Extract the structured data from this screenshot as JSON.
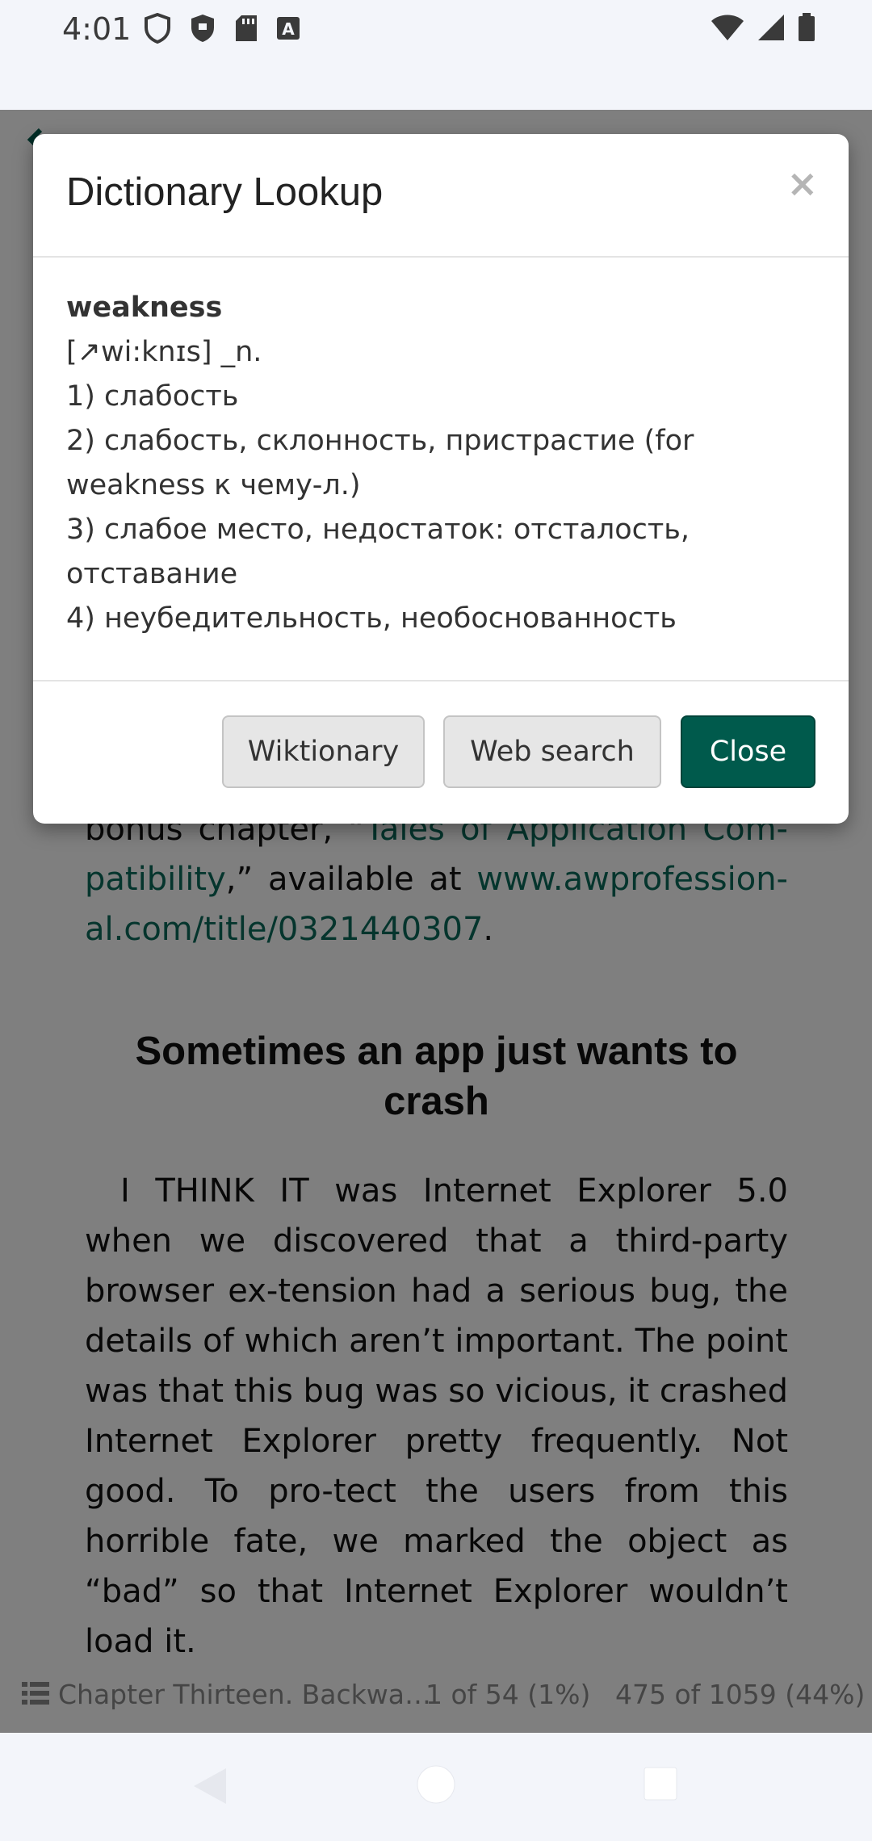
{
  "status_bar": {
    "time": "4:01",
    "left_icons": [
      "shield-outline-icon",
      "shield-filled-icon",
      "sd-card-icon",
      "font-a-icon"
    ],
    "right_icons": [
      "wifi-icon",
      "cell-signal-icon",
      "battery-icon"
    ]
  },
  "dialog": {
    "title": "Dictionary Lookup",
    "close_glyph": "×",
    "word": "weakness",
    "entry_lines": [
      "[↗wi:knɪs] _n.",
      "1) слабость",
      "2) слабость, склонность, пристрастие (for weakness к чему-л.)",
      "3) слабое место, недостаток: отсталость, отставание",
      "4) неубедительность, необоснованность"
    ],
    "buttons": {
      "wiktionary": "Wiktionary",
      "web_search": "Web search",
      "close": "Close"
    }
  },
  "reader": {
    "para1_text_a": "bonus chapter, “",
    "para1_link1": "Tales of Application Com-patibility",
    "para1_text_b": ",” available at ",
    "para1_link2": "www.awprofession-al.com/title/0321440307",
    "para1_text_c": ".",
    "heading": "Sometimes an app just wants to crash",
    "para2": "I THINK IT was Internet Explorer 5.0 when we discovered that a third-party browser ex-tension had a serious bug, the details of which aren’t important. The point was that this bug was so vicious, it crashed Internet Explorer pretty frequently. Not good. To pro-tect the users from this horrible fate, we marked the object as “bad” so that Internet Explorer wouldn’t load it.",
    "footer": {
      "chapter": "Chapter Thirteen. Backwa…",
      "chapter_progress": "1 of 54 (1%)",
      "book_progress": "475 of 1059 (44%)"
    }
  },
  "colors": {
    "accent": "#005a4c",
    "link": "#0a6a5a",
    "scrim": "rgba(0,0,0,0.5)"
  }
}
